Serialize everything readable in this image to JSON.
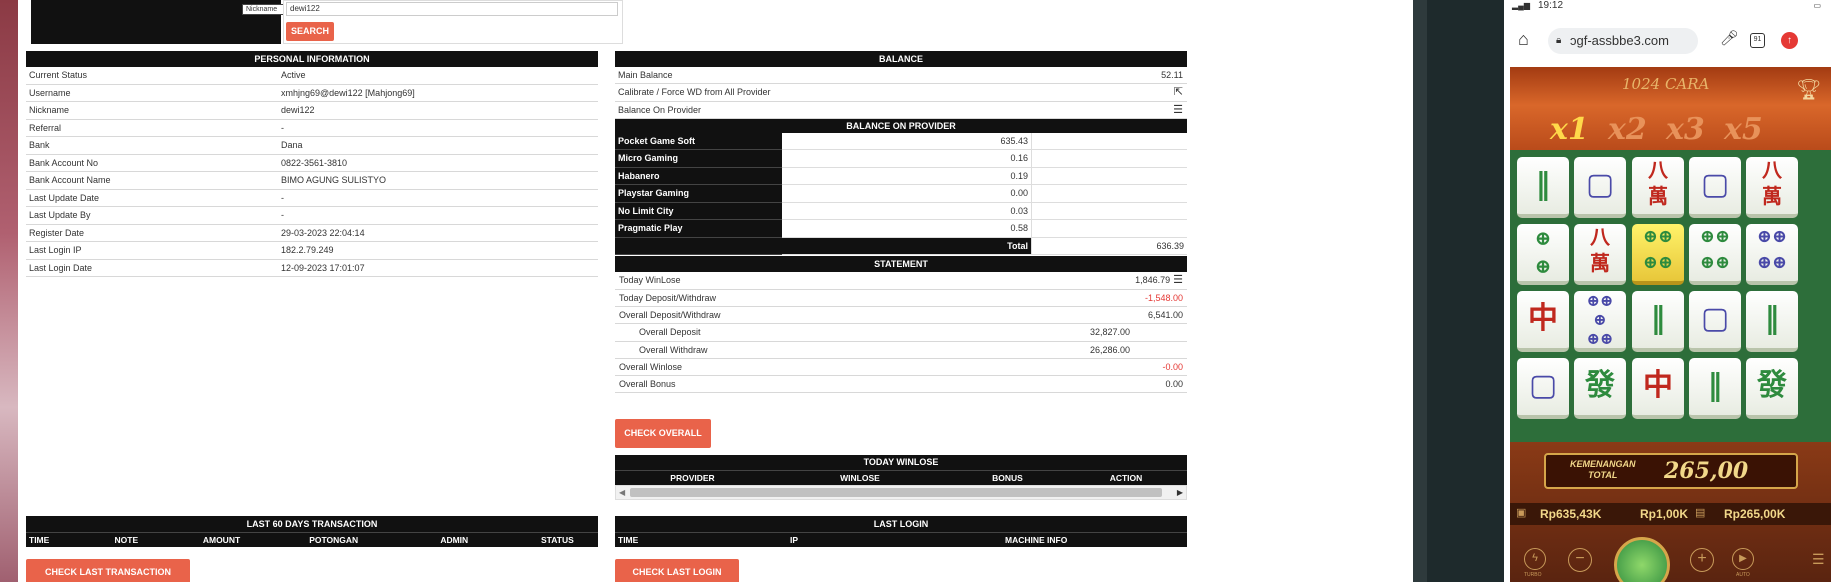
{
  "search": {
    "filter_value": "Nickname",
    "query_value": "dewi122",
    "button_label": "SEARCH"
  },
  "personal": {
    "title": "PERSONAL INFORMATION",
    "rows": [
      {
        "label": "Current Status",
        "value": "Active"
      },
      {
        "label": "Username",
        "value": "xmhjng69@dewi122  [Mahjong69]"
      },
      {
        "label": "Nickname",
        "value": "dewi122"
      },
      {
        "label": "Referral",
        "value": "-"
      },
      {
        "label": "Bank",
        "value": "Dana"
      },
      {
        "label": "Bank Account No",
        "value": "0822-3561-3810"
      },
      {
        "label": "Bank Account Name",
        "value": "BIMO AGUNG SULISTYO"
      },
      {
        "label": "Last Update Date",
        "value": "-"
      },
      {
        "label": "Last Update By",
        "value": "-"
      },
      {
        "label": "Register Date",
        "value": "29-03-2023 22:04:14"
      },
      {
        "label": "Last Login IP",
        "value": "182.2.79.249"
      },
      {
        "label": "Last Login Date",
        "value": "12-09-2023 17:01:07"
      }
    ]
  },
  "balance": {
    "title": "BALANCE",
    "main_label": "Main Balance",
    "main_value": "52.11",
    "calibrate_label": "Calibrate / Force WD from All Provider",
    "on_provider_label": "Balance On Provider",
    "provider_title": "BALANCE ON PROVIDER",
    "providers": [
      {
        "name": "Pocket Game Soft",
        "value": "635.43"
      },
      {
        "name": "Micro Gaming",
        "value": "0.16"
      },
      {
        "name": "Habanero",
        "value": "0.19"
      },
      {
        "name": "Playstar Gaming",
        "value": "0.00"
      },
      {
        "name": "No Limit City",
        "value": "0.03"
      },
      {
        "name": "Pragmatic Play",
        "value": "0.58"
      }
    ],
    "total_label": "Total",
    "total_value": "636.39"
  },
  "statement": {
    "title": "STATEMENT",
    "today_winlose_label": "Today WinLose",
    "today_winlose_value": "1,846.79",
    "today_dw_label": "Today Deposit/Withdraw",
    "today_dw_value": "-1,548.00",
    "overall_dw_label": "Overall Deposit/Withdraw",
    "overall_dw_value": "6,541.00",
    "overall_deposit_label": "Overall Deposit",
    "overall_deposit_value": "32,827.00",
    "overall_withdraw_label": "Overall Withdraw",
    "overall_withdraw_value": "26,286.00",
    "overall_winlose_label": "Overall Winlose",
    "overall_winlose_value": "-0.00",
    "overall_bonus_label": "Overall Bonus",
    "overall_bonus_value": "0.00",
    "check_button": "CHECK OVERALL",
    "negative_color": "#e53935"
  },
  "today_winlose": {
    "title": "TODAY WINLOSE",
    "columns": [
      "PROVIDER",
      "WINLOSE",
      "BONUS",
      "ACTION"
    ]
  },
  "last60": {
    "title": "LAST 60 DAYS TRANSACTION",
    "columns": [
      "TIME",
      "NOTE",
      "AMOUNT",
      "POTONGAN",
      "ADMIN",
      "STATUS"
    ],
    "button": "CHECK LAST TRANSACTION"
  },
  "lastlogin": {
    "title": "LAST LOGIN",
    "columns": [
      "TIME",
      "IP",
      "MACHINE INFO"
    ],
    "button": "CHECK LAST LOGIN"
  },
  "phone": {
    "time": "19:12",
    "url": "ɔgf-assbbe3.com",
    "tab_count": "91",
    "game_title": "1024 CARA",
    "multipliers": [
      "x1",
      "x2",
      "x3",
      "x5"
    ],
    "win_label_1": "KEMENANGAN",
    "win_label_2": "TOTAL",
    "win_value": "265,00",
    "balance_amt": "Rp635,43K",
    "bet_amt": "Rp1,00K",
    "win_amt": "Rp265,00K",
    "turbo_label": "TURBO",
    "auto_label": "AUTO",
    "accent_color": "#e9634a"
  }
}
